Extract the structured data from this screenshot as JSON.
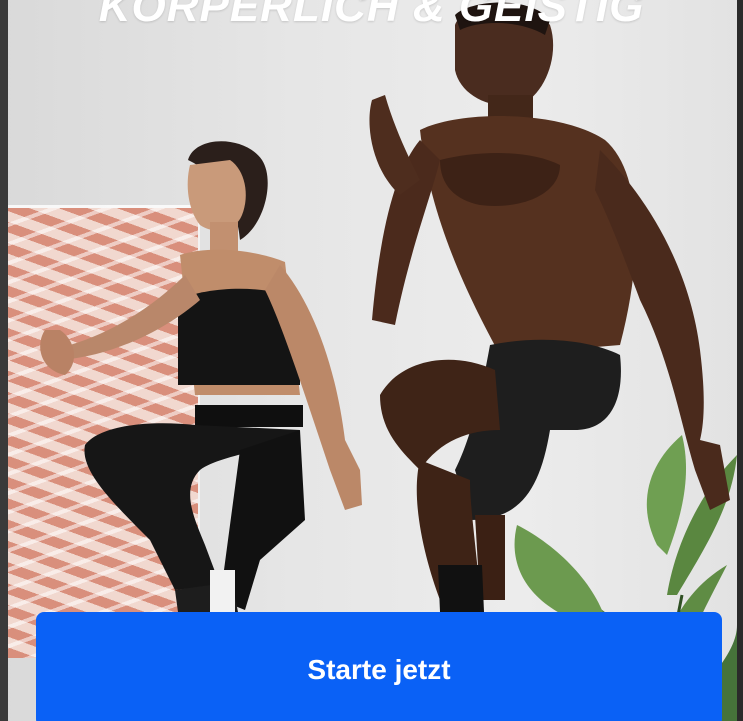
{
  "hero": {
    "title": "KÖRPERLICH & GEISTIG",
    "image_description_icon": "workout-photo"
  },
  "cta": {
    "label": "Starte jetzt"
  },
  "colors": {
    "accent": "#0a61f6",
    "title_text": "#ffffff"
  }
}
